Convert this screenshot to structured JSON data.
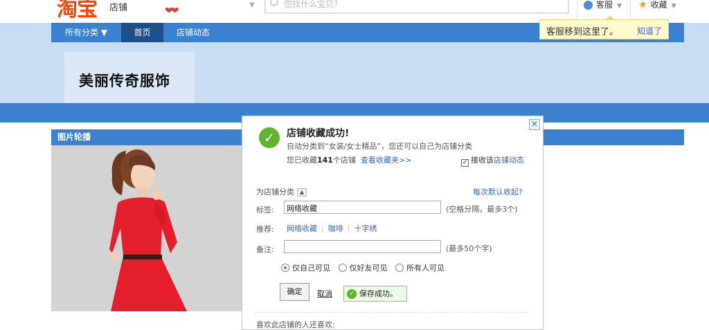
{
  "topbar": {
    "logo": "淘宝",
    "logo_sub": "店铺",
    "hearts": "❤❤",
    "search_placeholder": "您找什么宝贝?",
    "kefu_label": "客服",
    "fav_label": "收藏",
    "tooltip_text": "客服移到这里了。",
    "tooltip_link": "知道了"
  },
  "nav": {
    "items": [
      {
        "label": "所有分类 ▼"
      },
      {
        "label": "首页"
      },
      {
        "label": "店铺动态"
      }
    ]
  },
  "shop": {
    "title": "美丽传奇服饰"
  },
  "section": {
    "carousel_title": "图片轮播"
  },
  "dialog": {
    "close": "×",
    "title": "店铺收藏成功!",
    "desc": "自动分类到“女装/女士精品”，您还可以自己为店铺分类",
    "count_prefix": "您已收藏",
    "count": "141",
    "count_suffix": "个店铺",
    "view_link": "查看收藏夹>>",
    "receive_checked": true,
    "receive_label": "接收该",
    "receive_link": "店铺动态",
    "category_label": "为店铺分类",
    "collapse_link": "每次默认收起?",
    "tag_label": "标签:",
    "tag_value": "网络收藏",
    "tag_hint": "(空格分隔，最多3个)",
    "recommend_label": "推荐:",
    "recommend": [
      "网络收藏",
      "咖啡",
      "十字绣"
    ],
    "note_label": "备注:",
    "note_value": "",
    "note_hint": "(最多50个字)",
    "visibility": [
      "仅自己可见",
      "仅好友可见",
      "所有人可见"
    ],
    "visibility_selected": 0,
    "ok": "确定",
    "cancel": "取消",
    "saved": "保存成功。",
    "also_like": "喜欢此店铺的人还喜欢:"
  }
}
